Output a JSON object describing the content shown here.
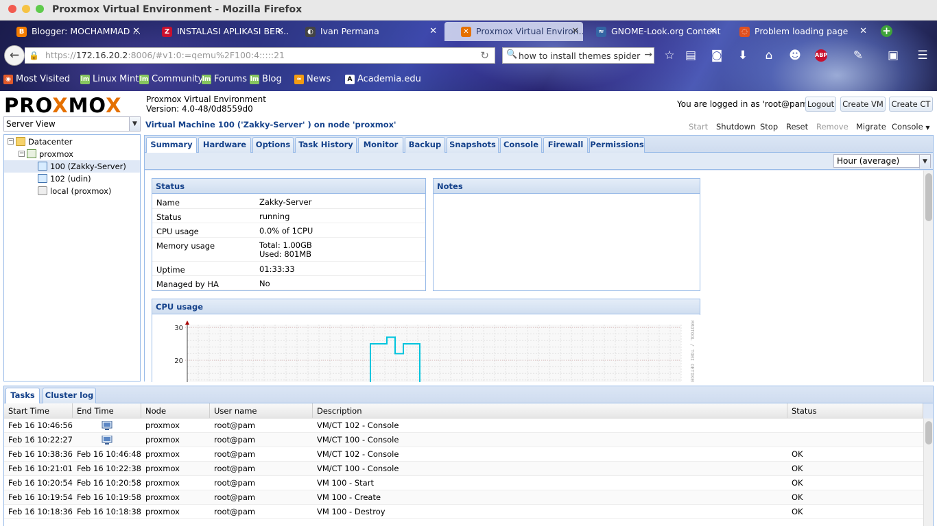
{
  "browser": {
    "window_title": "Proxmox Virtual Environment - Mozilla Firefox",
    "tabs": [
      {
        "label": "Blogger: MOCHAMMAD ...",
        "favicon": "blogger-icon",
        "favicon_color": "#f57d00",
        "favicon_glyph": "B"
      },
      {
        "label": "INSTALASI APLIKASI BER...",
        "favicon": "zotero-icon",
        "favicon_color": "#c8102e",
        "favicon_glyph": "Z"
      },
      {
        "label": "Ivan Permana",
        "favicon": "half-circle-icon",
        "favicon_color": "#444444",
        "favicon_glyph": "◐"
      },
      {
        "label": "Proxmox Virtual Environ...",
        "favicon": "proxmox-icon",
        "favicon_color": "#e57000",
        "favicon_glyph": "✕",
        "active": true
      },
      {
        "label": "GNOME-Look.org Content",
        "favicon": "rss-icon",
        "favicon_color": "#3465a4",
        "favicon_glyph": "≈"
      },
      {
        "label": "Problem loading page",
        "favicon": "loading-icon",
        "favicon_color": "#e05020",
        "favicon_glyph": "◌"
      }
    ],
    "url_prefix": "https://",
    "url_host": "172.16.20.2",
    "url_rest": ":8006/#v1:0:=qemu%2F100:4:::::21",
    "search_text": "how to install themes spider voice",
    "bookmarks": [
      {
        "label": "Most Visited",
        "icon": "most-visited-icon"
      },
      {
        "label": "Linux Mint",
        "icon": "mint-icon"
      },
      {
        "label": "Community",
        "icon": "mint-icon"
      },
      {
        "label": "Forums",
        "icon": "mint-icon"
      },
      {
        "label": "Blog",
        "icon": "mint-icon"
      },
      {
        "label": "News",
        "icon": "rss-icon"
      },
      {
        "label": "Academia.edu",
        "icon": "academia-icon"
      }
    ]
  },
  "header": {
    "logo_a": "PRO",
    "logo_x": "X",
    "logo_b": "MO",
    "logo_x2": "X",
    "product": "Proxmox Virtual Environment",
    "version": "Version: 4.0-48/0d8559d0",
    "logged_in": "You are logged in as 'root@pam'",
    "logout": "Logout",
    "create_vm": "Create VM",
    "create_ct": "Create CT"
  },
  "sidebar": {
    "view": "Server View",
    "tree": [
      {
        "label": "Datacenter",
        "type": "folder"
      },
      {
        "label": "proxmox",
        "type": "node"
      },
      {
        "label": "100 (Zakky-Server)",
        "type": "vm",
        "selected": true
      },
      {
        "label": "102 (udin)",
        "type": "vm"
      },
      {
        "label": "local (proxmox)",
        "type": "storage"
      }
    ]
  },
  "vm": {
    "title": "Virtual Machine 100 ('Zakky-Server' ) on node 'proxmox'",
    "actions": {
      "start": "Start",
      "shutdown": "Shutdown",
      "stop": "Stop",
      "reset": "Reset",
      "remove": "Remove",
      "migrate": "Migrate",
      "console": "Console"
    },
    "tabs": [
      "Summary",
      "Hardware",
      "Options",
      "Task History",
      "Monitor",
      "Backup",
      "Snapshots",
      "Console",
      "Firewall",
      "Permissions"
    ],
    "period": "Hour (average)",
    "status_title": "Status",
    "notes_title": "Notes",
    "status": [
      {
        "key": "Name",
        "value": "Zakky-Server"
      },
      {
        "key": "Status",
        "value": "running"
      },
      {
        "key": "CPU usage",
        "value": "0.0% of 1CPU"
      },
      {
        "key": "Memory usage",
        "value": "Total: 1.00GB",
        "value2": "Used: 801MB"
      },
      {
        "key": "Uptime",
        "value": "01:33:33"
      },
      {
        "key": "Managed by HA",
        "value": "No"
      }
    ],
    "cpu_title": "CPU usage",
    "watermark": "RRDTOOL / TOBI OETIKER"
  },
  "chart_data": {
    "type": "line",
    "title": "CPU usage",
    "yticks": [
      "30",
      "20"
    ],
    "ylim": [
      0,
      30
    ],
    "grid": true,
    "series": [
      {
        "values": [
          0,
          0,
          0,
          0,
          0,
          0,
          0,
          0,
          0,
          0,
          0,
          0,
          0,
          0,
          0,
          0,
          0,
          0,
          0,
          0,
          0,
          0,
          25,
          25,
          27,
          22,
          25,
          25,
          0,
          0,
          0,
          0,
          0,
          0,
          0,
          0,
          0,
          0,
          0,
          0
        ]
      }
    ],
    "color": "#00c4dd"
  },
  "tasks": {
    "tabs": [
      "Tasks",
      "Cluster log"
    ],
    "columns": [
      "Start Time",
      "End Time",
      "Node",
      "User name",
      "Description",
      "Status"
    ],
    "rows": [
      {
        "start": "Feb 16 10:46:56",
        "end": "",
        "running": true,
        "node": "proxmox",
        "user": "root@pam",
        "desc": "VM/CT 102 - Console",
        "status": ""
      },
      {
        "start": "Feb 16 10:22:27",
        "end": "",
        "running": true,
        "node": "proxmox",
        "user": "root@pam",
        "desc": "VM/CT 100 - Console",
        "status": ""
      },
      {
        "start": "Feb 16 10:38:36",
        "end": "Feb 16 10:46:48",
        "node": "proxmox",
        "user": "root@pam",
        "desc": "VM/CT 102 - Console",
        "status": "OK"
      },
      {
        "start": "Feb 16 10:21:01",
        "end": "Feb 16 10:22:38",
        "node": "proxmox",
        "user": "root@pam",
        "desc": "VM/CT 100 - Console",
        "status": "OK"
      },
      {
        "start": "Feb 16 10:20:54",
        "end": "Feb 16 10:20:58",
        "node": "proxmox",
        "user": "root@pam",
        "desc": "VM 100 - Start",
        "status": "OK"
      },
      {
        "start": "Feb 16 10:19:54",
        "end": "Feb 16 10:19:58",
        "node": "proxmox",
        "user": "root@pam",
        "desc": "VM 100 - Create",
        "status": "OK"
      },
      {
        "start": "Feb 16 10:18:36",
        "end": "Feb 16 10:18:38",
        "node": "proxmox",
        "user": "root@pam",
        "desc": "VM 100 - Destroy",
        "status": "OK"
      }
    ]
  }
}
